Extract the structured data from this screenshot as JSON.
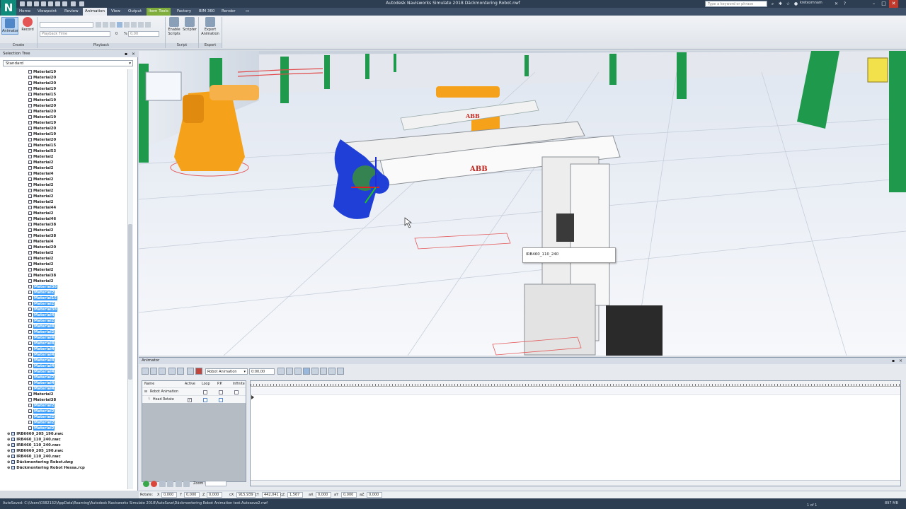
{
  "app": {
    "logo": "N",
    "title": "Autodesk Navisworks Simulate 2018  Däckmontering Robot.nwf",
    "search_placeholder": "Type a keyword or phrase",
    "user": "kretexmnam"
  },
  "ribbon": {
    "tabs": [
      "Home",
      "Viewpoint",
      "Review",
      "Animation",
      "View",
      "Output",
      "Item Tools",
      "Factory",
      "BIM 360",
      "Render"
    ],
    "active_tab": "Animation",
    "context_tab": "Item Tools",
    "buttons": {
      "animator": "Animator",
      "record": "Record",
      "enable_scripts": "Enable Scripts",
      "scripter": "Scripter",
      "export_animation": "Export Animation"
    },
    "playback": {
      "playback_time_placeholder": "Playback Time",
      "frame": "0",
      "percent": "0,00"
    },
    "groups": [
      "Create",
      "Playback",
      "Script",
      "Export"
    ]
  },
  "selection_tree": {
    "title": "Selection Tree",
    "mode": "Standard",
    "items": [
      {
        "label": "Material19",
        "sel": false
      },
      {
        "label": "Material20",
        "sel": false
      },
      {
        "label": "Material20",
        "sel": false
      },
      {
        "label": "Material19",
        "sel": false
      },
      {
        "label": "Material15",
        "sel": false
      },
      {
        "label": "Material19",
        "sel": false
      },
      {
        "label": "Material20",
        "sel": false
      },
      {
        "label": "Material20",
        "sel": false
      },
      {
        "label": "Material19",
        "sel": false
      },
      {
        "label": "Material19",
        "sel": false
      },
      {
        "label": "Material20",
        "sel": false
      },
      {
        "label": "Material19",
        "sel": false
      },
      {
        "label": "Material20",
        "sel": false
      },
      {
        "label": "Material15",
        "sel": false
      },
      {
        "label": "Material53",
        "sel": false
      },
      {
        "label": "Material2",
        "sel": false
      },
      {
        "label": "Material2",
        "sel": false
      },
      {
        "label": "Material2",
        "sel": false
      },
      {
        "label": "Material4",
        "sel": false
      },
      {
        "label": "Material2",
        "sel": false
      },
      {
        "label": "Material2",
        "sel": false
      },
      {
        "label": "Material2",
        "sel": false
      },
      {
        "label": "Material2",
        "sel": false
      },
      {
        "label": "Material2",
        "sel": false
      },
      {
        "label": "Material44",
        "sel": false
      },
      {
        "label": "Material2",
        "sel": false
      },
      {
        "label": "Material46",
        "sel": false
      },
      {
        "label": "Material38",
        "sel": false
      },
      {
        "label": "Material2",
        "sel": false
      },
      {
        "label": "Material38",
        "sel": false
      },
      {
        "label": "Material4",
        "sel": false
      },
      {
        "label": "Material20",
        "sel": false
      },
      {
        "label": "Material2",
        "sel": false
      },
      {
        "label": "Material2",
        "sel": false
      },
      {
        "label": "Material2",
        "sel": false
      },
      {
        "label": "Material2",
        "sel": false
      },
      {
        "label": "Material38",
        "sel": false
      },
      {
        "label": "Material2",
        "sel": false
      },
      {
        "label": "Material38",
        "sel": true
      },
      {
        "label": "Material2",
        "sel": true
      },
      {
        "label": "Material15",
        "sel": true
      },
      {
        "label": "Material2",
        "sel": true
      },
      {
        "label": "Material38",
        "sel": true
      },
      {
        "label": "Material4",
        "sel": true
      },
      {
        "label": "Material2",
        "sel": true
      },
      {
        "label": "Material4",
        "sel": true
      },
      {
        "label": "Material2",
        "sel": true
      },
      {
        "label": "Material4",
        "sel": true
      },
      {
        "label": "Material4",
        "sel": true
      },
      {
        "label": "Material4",
        "sel": true
      },
      {
        "label": "Material4",
        "sel": true
      },
      {
        "label": "Material4",
        "sel": true
      },
      {
        "label": "Material4",
        "sel": true
      },
      {
        "label": "Material4",
        "sel": true
      },
      {
        "label": "Material2",
        "sel": true
      },
      {
        "label": "Material4",
        "sel": true
      },
      {
        "label": "Material4",
        "sel": true
      },
      {
        "label": "Material2",
        "sel": false
      },
      {
        "label": "Material38",
        "sel": false
      },
      {
        "label": "Material2",
        "sel": true
      },
      {
        "label": "Material2",
        "sel": true
      },
      {
        "label": "Material2",
        "sel": true
      },
      {
        "label": "Material2",
        "sel": true
      },
      {
        "label": "Material2",
        "sel": true
      }
    ],
    "files": [
      "IRB6660_205_190.nwc",
      "IRB460_110_240.nwc",
      "IRB460_110_240.nwc",
      "IRB6660_205_190.nwc",
      "IRB460_110_240.nwc",
      "Däckmontering Robot.dwg",
      "Däckmontering Robot Hessa.rcp"
    ]
  },
  "viewport": {
    "tooltip": "IRB460_110_240",
    "brand_label": "ABB"
  },
  "animator": {
    "title": "Animator",
    "scene_select": "Robot Animation",
    "time": "0:00,00",
    "columns": [
      "Name",
      "Active",
      "Loop",
      "P.P.",
      "Infinite"
    ],
    "rows": [
      {
        "name": "Robot Animation",
        "active": false,
        "loop": false,
        "pp": false,
        "infinite": false
      },
      {
        "name": "Head Rotate",
        "active": true,
        "loop": false,
        "pp": false,
        "infinite": false
      }
    ],
    "zoom_label": "Zoom:"
  },
  "coords": {
    "mode": "Rotate:",
    "x": "0,000",
    "y": "0,000",
    "z": "0,000",
    "cx": "915,939",
    "cy": "442,041",
    "cz": "1,567",
    "ax": "0,000",
    "ay": "0,000",
    "az": "0,000"
  },
  "status": {
    "text": "AutoSaved: C:\\Users\\0382132\\AppData\\Roaming\\Autodesk Navisworks Simulate 2018\\AutoSave\\Däckmontering Robot Animation test.Autosave2.nwf",
    "page": "1 of 1",
    "mem": "897 MB"
  },
  "colors": {
    "title_bar": "#2d3e53",
    "tab_bar": "#3f5168",
    "context_tab": "#7fae3c",
    "selection": "#3399ff",
    "robot_orange": "#f5a11a",
    "gizmo_blue": "#1f3fd6"
  }
}
